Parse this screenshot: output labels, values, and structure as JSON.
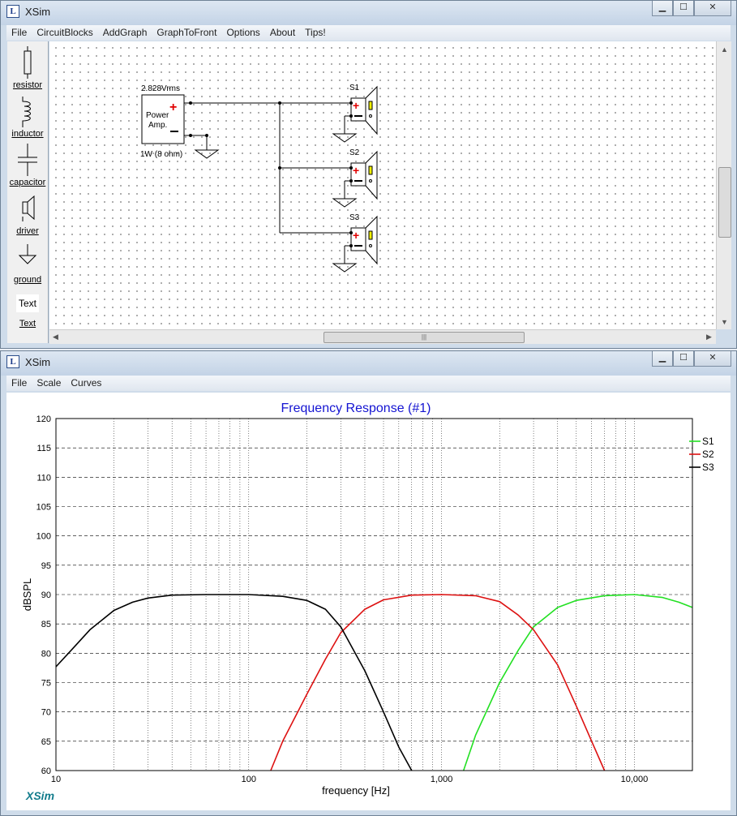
{
  "top_window": {
    "title": "XSim",
    "menu": [
      "File",
      "CircuitBlocks",
      "AddGraph",
      "GraphToFront",
      "Options",
      "About",
      "Tips!"
    ],
    "toolbox": [
      "resistor",
      "inductor",
      "capacitor",
      "driver",
      "ground",
      "Text"
    ],
    "text_tool_preview": "Text",
    "scrollbar_grip": "|||",
    "buttons": {
      "minimize": "▁",
      "maximize": "☐",
      "close": "✕"
    },
    "circuit": {
      "amp_voltage": "2.828Vrms",
      "amp_label_line1": "Power",
      "amp_label_line2": "Amp.",
      "amp_power": "1W (8 ohm)",
      "drivers": [
        "S1",
        "S2",
        "S3"
      ]
    }
  },
  "bottom_window": {
    "title": "XSim",
    "menu": [
      "File",
      "Scale",
      "Curves"
    ],
    "buttons": {
      "minimize": "▁",
      "maximize": "☐",
      "close": "✕"
    },
    "brand": "XSim"
  },
  "colors": {
    "S1": "#22e022",
    "S2": "#dd1111",
    "S3": "#000000",
    "title": "#1414d2",
    "brand": "#127c8c"
  },
  "chart_data": {
    "type": "line",
    "title": "Frequency Response (#1)",
    "xlabel": "frequency [Hz]",
    "ylabel": "dBSPL",
    "xscale": "log",
    "xlim": [
      10,
      20000
    ],
    "ylim": [
      60,
      120
    ],
    "yticks": [
      60,
      65,
      70,
      75,
      80,
      85,
      90,
      95,
      100,
      105,
      110,
      115,
      120
    ],
    "xtick_labels": [
      {
        "v": 10,
        "t": "10"
      },
      {
        "v": 100,
        "t": "100"
      },
      {
        "v": 1000,
        "t": "1,000"
      },
      {
        "v": 10000,
        "t": "10,000"
      }
    ],
    "legend": "top-right",
    "series": [
      {
        "name": "S1",
        "color": "#22e022",
        "points": [
          [
            1300,
            60
          ],
          [
            1500,
            66
          ],
          [
            2000,
            75
          ],
          [
            2500,
            80.5
          ],
          [
            3000,
            84.5
          ],
          [
            4000,
            87.8
          ],
          [
            5000,
            89
          ],
          [
            7000,
            89.8
          ],
          [
            10000,
            90
          ],
          [
            14000,
            89.5
          ],
          [
            17000,
            88.7
          ],
          [
            20000,
            87.8
          ]
        ]
      },
      {
        "name": "S2",
        "color": "#dd1111",
        "points": [
          [
            130,
            60
          ],
          [
            150,
            65
          ],
          [
            200,
            73
          ],
          [
            250,
            79
          ],
          [
            300,
            83.5
          ],
          [
            400,
            87.5
          ],
          [
            500,
            89.1
          ],
          [
            700,
            89.9
          ],
          [
            1000,
            90
          ],
          [
            1500,
            89.8
          ],
          [
            2000,
            88.8
          ],
          [
            2500,
            86.5
          ],
          [
            3000,
            84
          ],
          [
            4000,
            78
          ],
          [
            5000,
            71
          ],
          [
            6000,
            65
          ],
          [
            7000,
            60
          ]
        ]
      },
      {
        "name": "S3",
        "color": "#000000",
        "points": [
          [
            10,
            77.7
          ],
          [
            12,
            80.5
          ],
          [
            15,
            84
          ],
          [
            20,
            87.3
          ],
          [
            25,
            88.7
          ],
          [
            30,
            89.4
          ],
          [
            40,
            89.9
          ],
          [
            60,
            90
          ],
          [
            100,
            90
          ],
          [
            150,
            89.7
          ],
          [
            200,
            89
          ],
          [
            250,
            87.5
          ],
          [
            300,
            84.5
          ],
          [
            400,
            77
          ],
          [
            500,
            70
          ],
          [
            600,
            64
          ],
          [
            700,
            60
          ]
        ]
      }
    ]
  }
}
